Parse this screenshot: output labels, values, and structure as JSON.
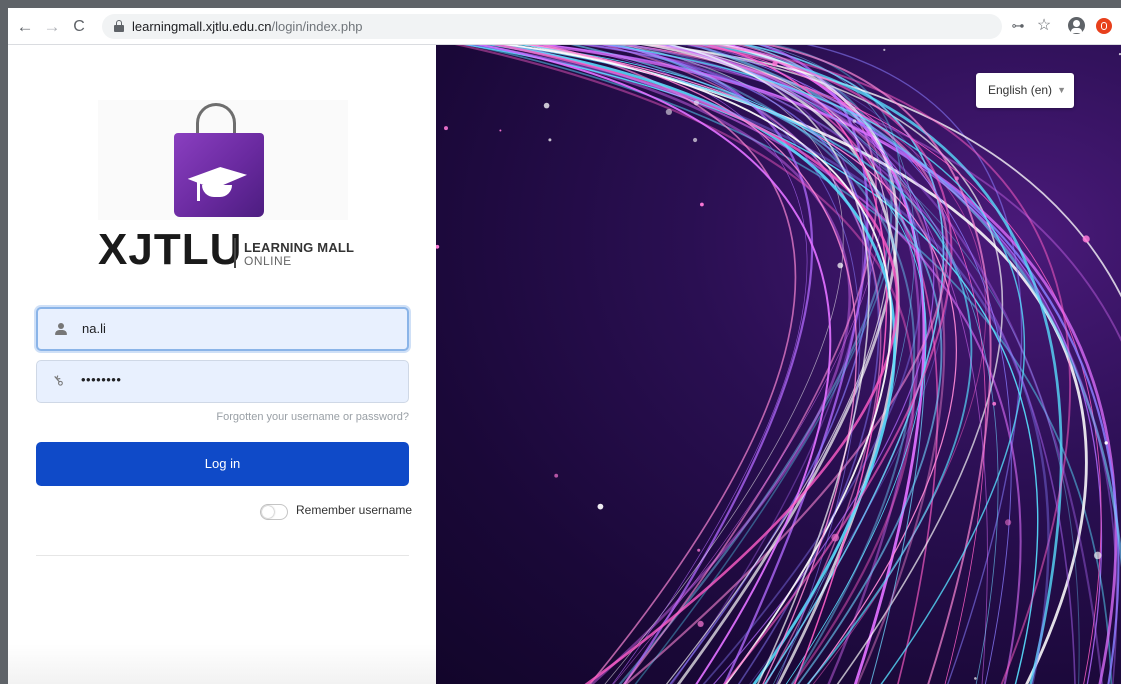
{
  "browser": {
    "url_host": "learningmall.xjtlu.edu.cn",
    "url_path": "/login/index.php"
  },
  "logo": {
    "brand": "XJTLU",
    "line1": "LEARNING MALL",
    "line2": "ONLINE"
  },
  "login": {
    "username_value": "na.li",
    "password_value": "••••••••",
    "forgot_link": "Forgotten your username or password?",
    "login_button": "Log in",
    "remember_label": "Remember username",
    "remember_checked": false
  },
  "language": {
    "selected": "English (en)"
  },
  "colors": {
    "login_button": "#0f4ac8",
    "field_bg": "#e8f0fe"
  }
}
